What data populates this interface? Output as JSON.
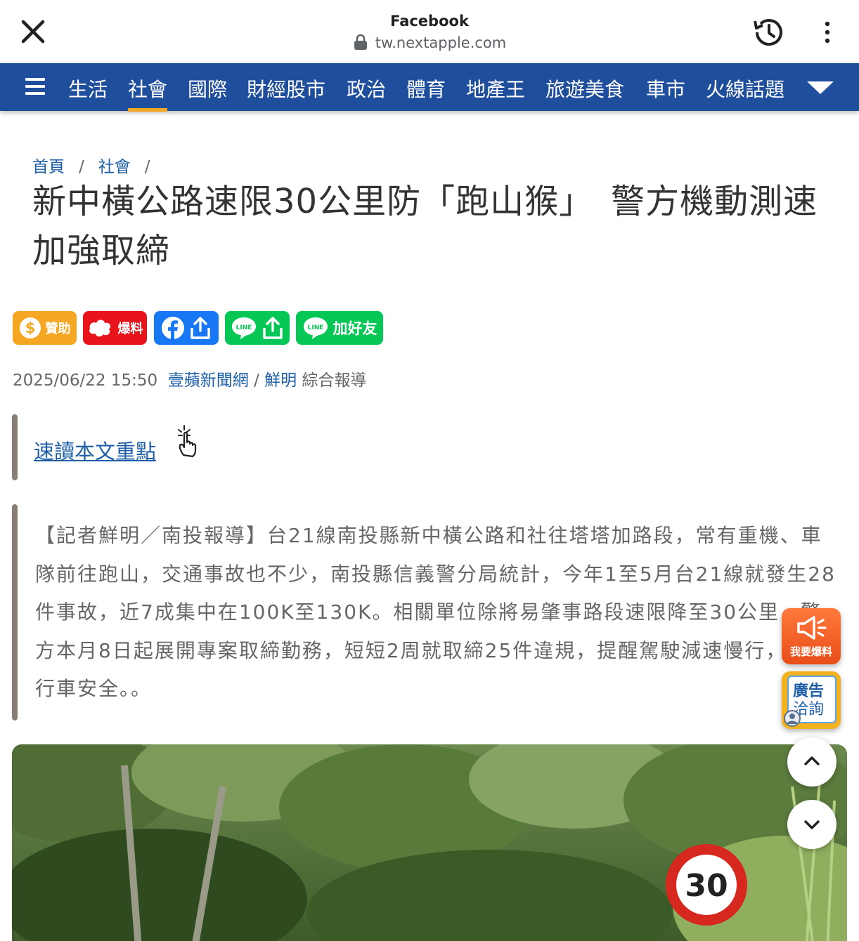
{
  "browser": {
    "site_name": "Facebook",
    "url": "tw.nextapple.com"
  },
  "nav": {
    "items": [
      "生活",
      "社會",
      "國際",
      "財經股市",
      "政治",
      "體育",
      "地產王",
      "旅遊美食",
      "車市",
      "火線話題"
    ],
    "active": "社會"
  },
  "breadcrumb": {
    "home": "首頁",
    "section": "社會",
    "sep": "/"
  },
  "article": {
    "title": "新中橫公路速限30公里防「跑山猴」　警方機動測速加強取締",
    "date": "2025/06/22 15:50",
    "source": "壹蘋新聞網",
    "source_sep": "/",
    "author": "鮮明",
    "report_type": "綜合報導",
    "quick_read": "速讀本文重點",
    "lead": "【記者鮮明／南投報導】台21線南投縣新中橫公路和社往塔塔加路段，常有重機、車隊前往跑山，交通事故也不少，南投縣信義警分局統計，今年1至5月台21線就發生28件事故，近7成集中在100K至130K。相關單位除將易肇事路段速限降至30公里，警方本月8日起展開專案取締勤務，短短2周就取締25件違規，提醒駕駛減速慢行，注意行車安全。。"
  },
  "share": {
    "sponsor": "贊助",
    "report": "爆料",
    "add_friend": "加好友",
    "line_badge": "LINE"
  },
  "floating": {
    "report_label": "我要爆料",
    "ad_line1": "廣告",
    "ad_line2": "洽詢"
  },
  "photo": {
    "sign_text": "30"
  },
  "colors": {
    "nav_bg": "#1f4f9c",
    "active_underline": "#f5a623",
    "link": "#1f5fa8",
    "sponsor": "#f5a623",
    "report": "#e8141c",
    "facebook": "#1877f2",
    "line": "#06c755"
  }
}
